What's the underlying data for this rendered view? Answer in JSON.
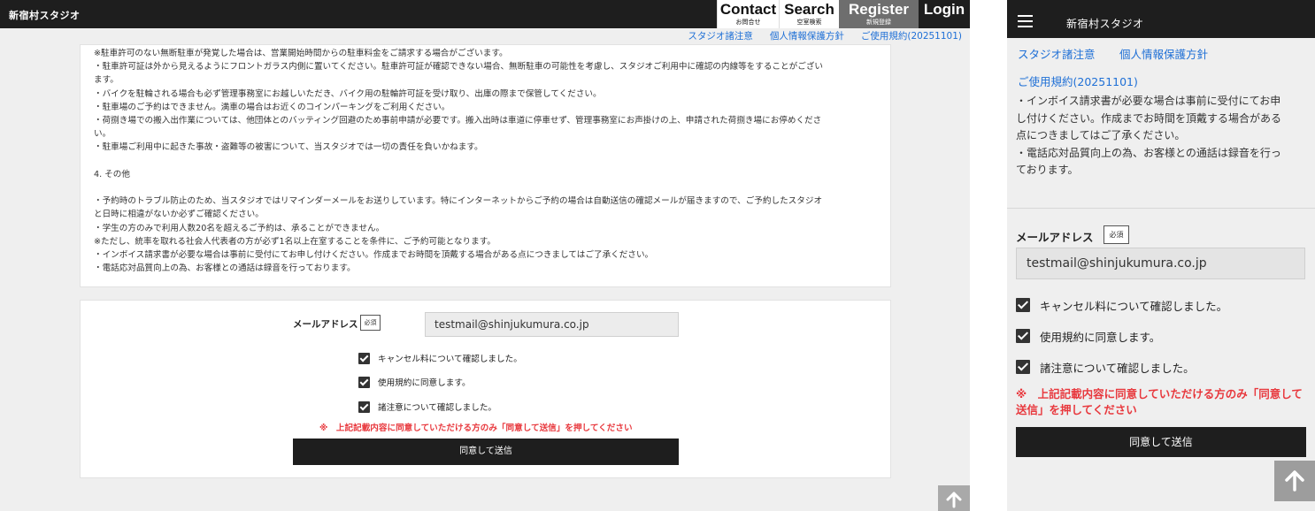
{
  "desktop": {
    "logo": "新宿村スタジオ",
    "nav": [
      {
        "en": "Contact",
        "jp": "お問合せ"
      },
      {
        "en": "Search",
        "jp": "空室検索"
      },
      {
        "en": "Register",
        "jp": "新規登録"
      },
      {
        "en": "Login",
        "jp": ""
      }
    ],
    "sublinks": [
      "スタジオ諸注意",
      "個人情報保護方針",
      "ご使用規約(20251101)"
    ],
    "terms": [
      "※駐車許可のない無断駐車が発覚した場合は、営業開始時間からの駐車料金をご請求する場合がございます。",
      "・駐車許可証は外から見えるようにフロントガラス内側に置いてください。駐車許可証が確認できない場合、無断駐車の可能性を考慮し、スタジオご利用中に確認の内線等をすることがござい",
      "ます。",
      "・バイクを駐輪される場合も必ず管理事務室にお越しいただき、バイク用の駐輪許可証を受け取り、出庫の際まで保管してください。",
      "・駐車場のご予約はできません。満車の場合はお近くのコインパーキングをご利用ください。",
      "・荷捌き場での搬入出作業については、他団体とのバッティング回避のため事前申請が必要です。搬入出時は車道に停車せず、管理事務室にお声掛けの上、申請された荷捌き場にお停めくださ",
      "い。",
      "・駐車場ご利用中に起きた事故・盗難等の被害について、当スタジオでは一切の責任を負いかねます。",
      "",
      "4. その他",
      "",
      "・予約時のトラブル防止のため、当スタジオではリマインダーメールをお送りしています。特にインターネットからご予約の場合は自動送信の確認メールが届きますので、ご予約したスタジオ",
      "と日時に相違がないか必ずご確認ください。",
      "・学生の方のみで利用人数20名を超えるご予約は、承ることができません。",
      "※ただし、統率を取れる社会人代表者の方が必ず1名以上在室することを条件に、ご予約可能となります。",
      "・インボイス請求書が必要な場合は事前に受付にてお申し付けください。作成までお時間を頂戴する場合がある点につきましてはご了承ください。",
      "・電話応対品質向上の為、お客様との通話は録音を行っております。"
    ],
    "form": {
      "email_label": "メールアドレス",
      "required": "必須",
      "email_value": "testmail@shinjukumura.co.jp",
      "checks": [
        "キャンセル料について確認しました。",
        "使用規約に同意します。",
        "諸注意について確認しました。"
      ],
      "note": "※　上記記載内容に同意していただける方のみ「同意して送信」を押してください",
      "submit": "同意して送信"
    }
  },
  "mobile": {
    "logo": "新宿村スタジオ",
    "links": [
      "スタジオ諸注意",
      "個人情報保護方針",
      "ご使用規約(20251101)"
    ],
    "terms": [
      "・インボイス請求書が必要な場合は事前に受付にてお申",
      "し付けください。作成までお時間を頂戴する場合がある",
      "点につきましてはご了承ください。",
      "・電話応対品質向上の為、お客様との通話は録音を行っ",
      "ております。"
    ],
    "form": {
      "email_label": "メールアドレス",
      "required": "必須",
      "email_value": "testmail@shinjukumura.co.jp",
      "checks": [
        "キャンセル料について確認しました。",
        "使用規約に同意します。",
        "諸注意について確認しました。"
      ],
      "note": "※　上記記載内容に同意していただける方のみ「同意して送信」を押してください",
      "submit": "同意して送信"
    }
  },
  "icons": {
    "check": "checkbox-checked-icon",
    "top": "arrow-up-icon",
    "menu": "hamburger-menu-icon"
  }
}
